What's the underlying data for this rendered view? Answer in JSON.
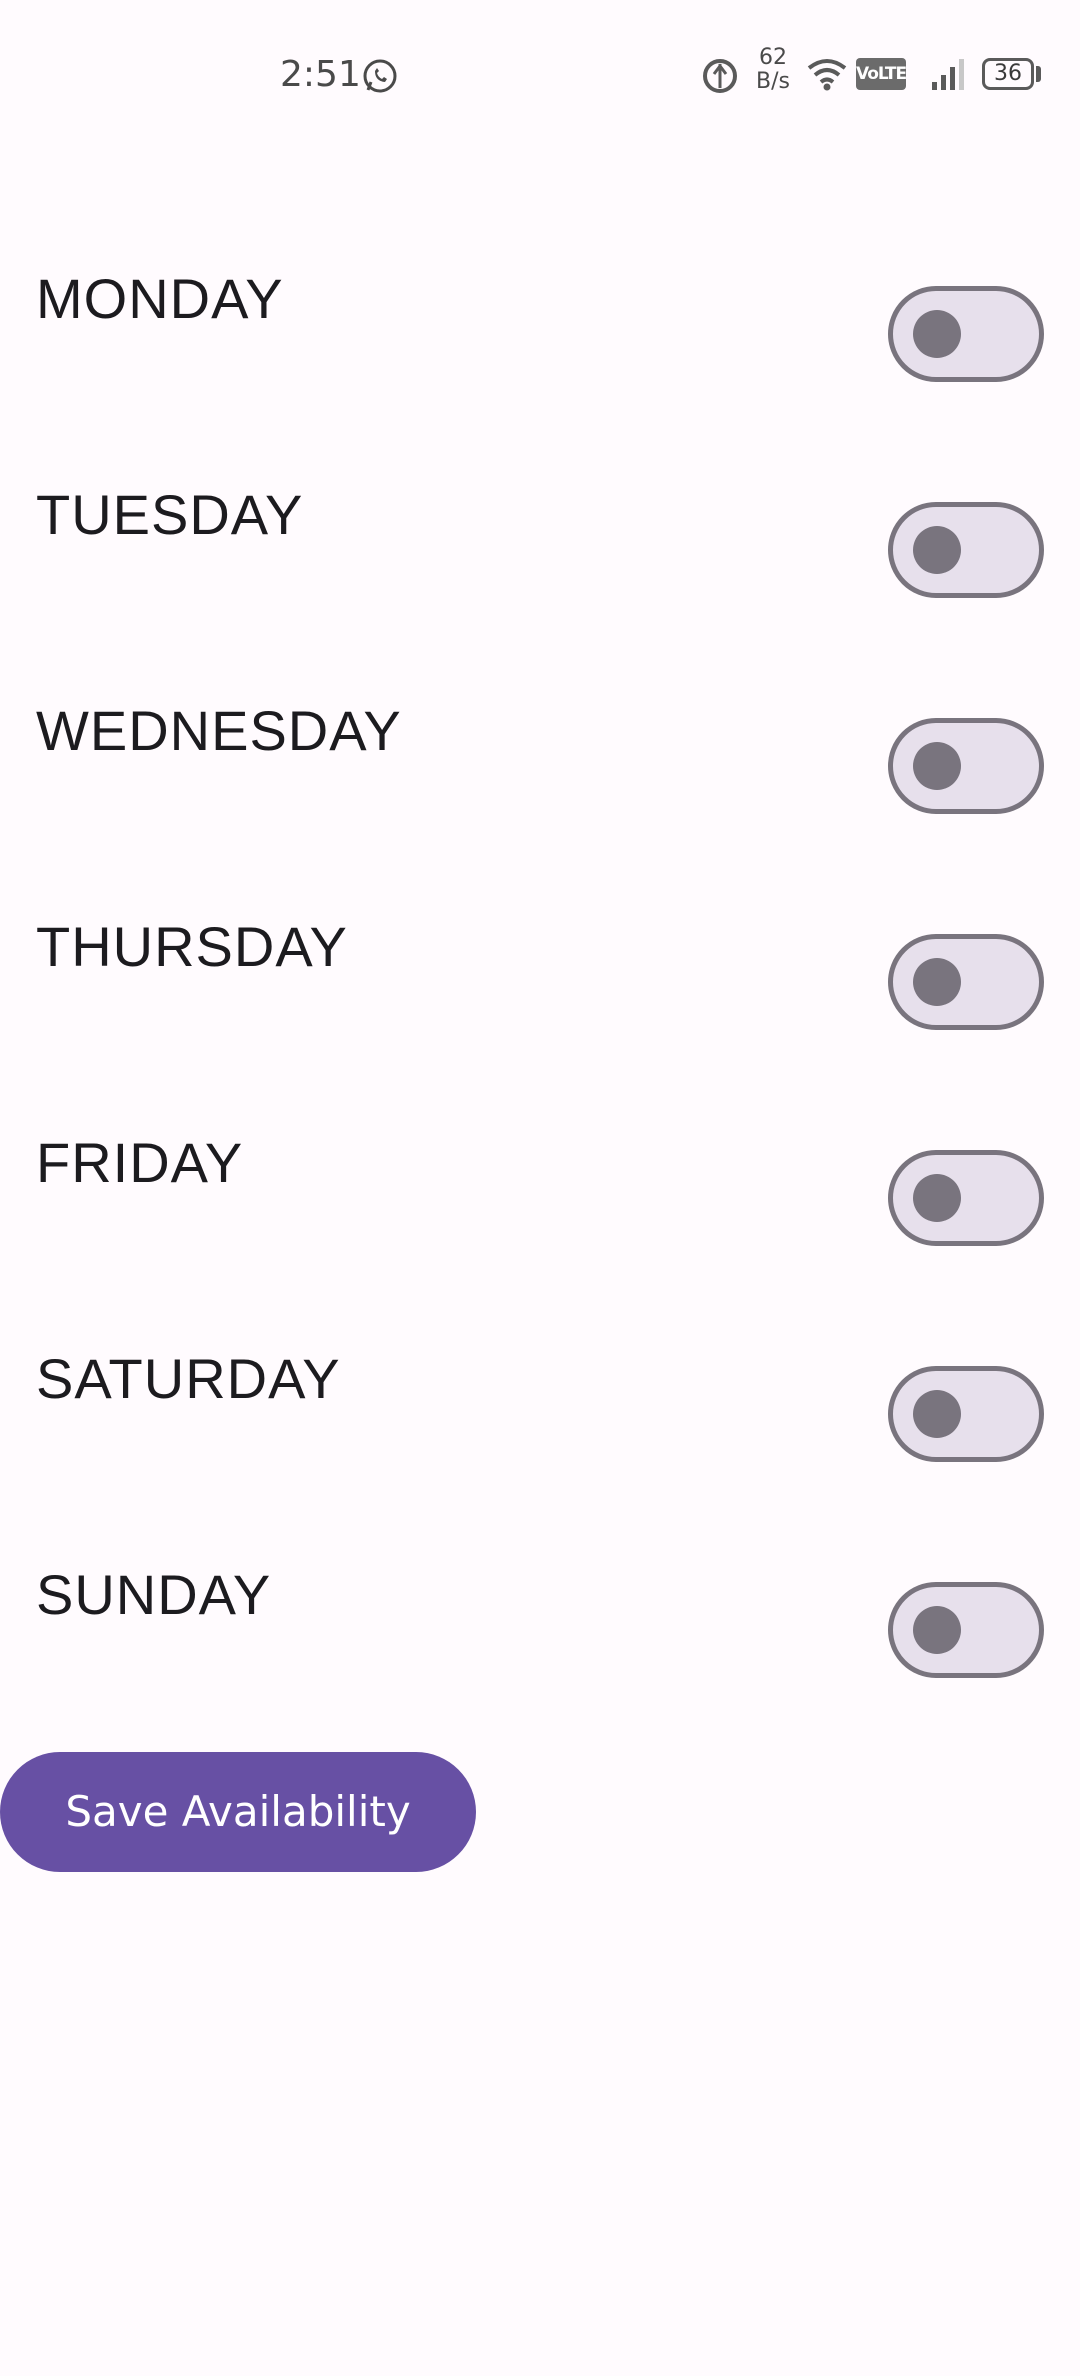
{
  "status_bar": {
    "time": "2:51",
    "net_speed_value": "62",
    "net_speed_unit": "B/s",
    "volte": "VoLTE",
    "battery": "36",
    "icons": [
      "whatsapp-icon",
      "data-saver-icon",
      "wifi-icon",
      "volte-icon",
      "signal-icon",
      "battery-icon"
    ]
  },
  "days": [
    {
      "label": "MONDAY",
      "enabled": false
    },
    {
      "label": "TUESDAY",
      "enabled": false
    },
    {
      "label": "WEDNESDAY",
      "enabled": false
    },
    {
      "label": "THURSDAY",
      "enabled": false
    },
    {
      "label": "FRIDAY",
      "enabled": false
    },
    {
      "label": "SATURDAY",
      "enabled": false
    },
    {
      "label": "SUNDAY",
      "enabled": false
    }
  ],
  "save_button": {
    "label": "Save Availability"
  },
  "colors": {
    "background": "#fffbfe",
    "primary": "#6750a4",
    "switch_outline": "#79747e",
    "switch_track": "#e7e0ec",
    "text": "#1c1b1f"
  }
}
